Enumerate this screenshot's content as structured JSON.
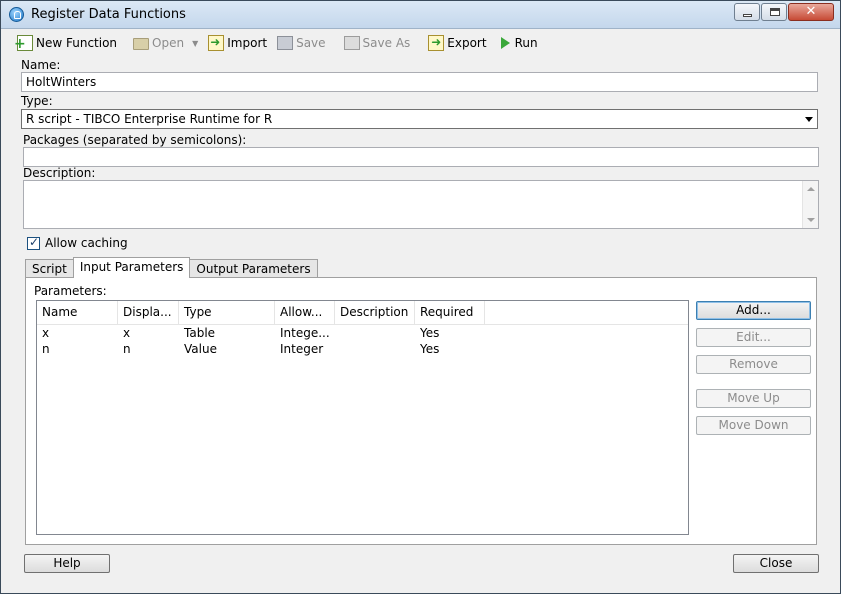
{
  "window": {
    "title": "Register Data Functions"
  },
  "toolbar": {
    "new_function": "New Function",
    "open": "Open",
    "import": "Import",
    "save": "Save",
    "save_as": "Save As",
    "export": "Export",
    "run": "Run"
  },
  "form": {
    "name_label": "Name:",
    "name_value": "HoltWinters",
    "type_label": "Type:",
    "type_value": "R script - TIBCO Enterprise Runtime for R",
    "packages_label": "Packages (separated by semicolons):",
    "packages_value": "",
    "description_label": "Description:",
    "description_value": "",
    "allow_caching_label": "Allow caching",
    "allow_caching_checked": true
  },
  "tabs": [
    {
      "label": "Script",
      "active": false
    },
    {
      "label": "Input Parameters",
      "active": true
    },
    {
      "label": "Output Parameters",
      "active": false
    }
  ],
  "parameters": {
    "label": "Parameters:",
    "columns": [
      "Name",
      "Displa...",
      "Type",
      "Allow...",
      "Description",
      "Required"
    ],
    "rows": [
      [
        "x",
        "x",
        "Table",
        "Intege...",
        "",
        "Yes"
      ],
      [
        "n",
        "n",
        "Value",
        "Integer",
        "",
        "Yes"
      ]
    ]
  },
  "side_buttons": {
    "add": "Add...",
    "edit": "Edit...",
    "remove": "Remove",
    "move_up": "Move Up",
    "move_down": "Move Down"
  },
  "footer": {
    "help": "Help",
    "close": "Close"
  }
}
